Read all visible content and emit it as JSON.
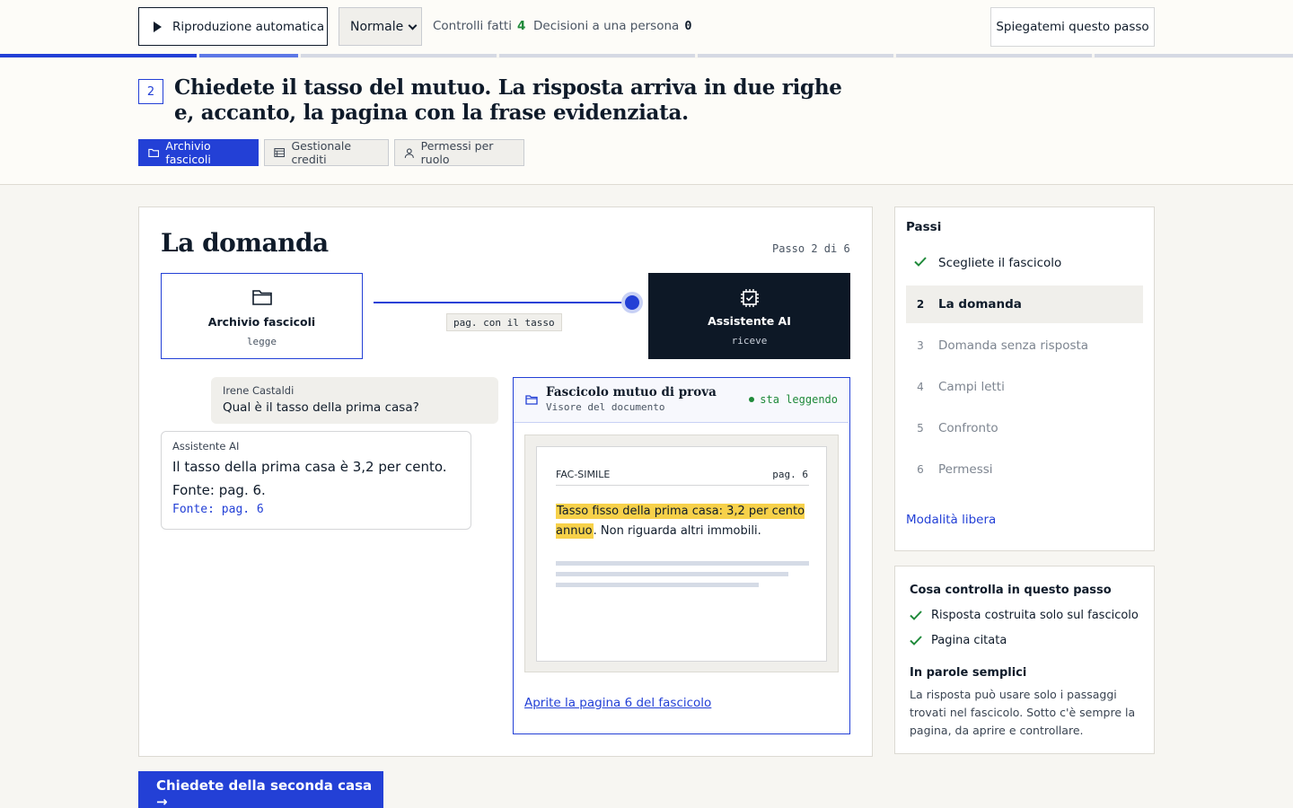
{
  "topbar": {
    "autoplay_label": "Riproduzione automatica",
    "speed_value": "Normale",
    "checks_label": "Controlli fatti",
    "checks_count": "4",
    "decisions_label": "Decisioni a una persona",
    "decisions_count": "0",
    "explain_label": "Spiegatemi questo passo"
  },
  "progress": {
    "segments_total": 6,
    "current_segment": 2,
    "current_segment_fill": 1.0,
    "colors": {
      "done": "#2340d6",
      "current": "#5d78e6",
      "pending": "#d5d9e3"
    }
  },
  "header": {
    "step_number": "2",
    "title": "Chiedete il tasso del mutuo. La risposta arriva in due righe e, accanto, la pagina con la frase evidenziata.",
    "sources": [
      {
        "label": "Archivio fascicoli",
        "icon": "folder-icon",
        "active": true
      },
      {
        "label": "Gestionale crediti",
        "icon": "table-icon",
        "active": false
      },
      {
        "label": "Permessi per ruolo",
        "icon": "person-icon",
        "active": false
      }
    ]
  },
  "card": {
    "title": "La domanda",
    "step_of": "Passo 2 di 6",
    "flow": {
      "source": {
        "name": "Archivio fascicoli",
        "role": "legge",
        "icon": "folder-icon"
      },
      "target": {
        "name": "Assistente AI",
        "role": "riceve",
        "icon": "chip-check-icon"
      },
      "label": "pag. con il tasso"
    },
    "chat": {
      "user_name": "Irene Castaldi",
      "user_msg": "Qual è il tasso della prima casa?",
      "ai_name": "Assistente AI",
      "ai_line1": "Il tasso della prima casa è 3,2 per cento.",
      "ai_line2": "Fonte: pag. 6.",
      "ai_cite": "Fonte: pag. 6"
    },
    "doc": {
      "title": "Fascicolo mutuo di prova",
      "subtitle": "Visore del documento",
      "status": "sta leggendo",
      "page_label": "FAC-SIMILE",
      "page_num": "pag. 6",
      "highlight": "Tasso fisso della prima casa: 3,2 per cento annuo",
      "rest": ". Non riguarda altri immobili.",
      "link": "Aprite la pagina 6 del fascicolo"
    },
    "next_button": "Chiedete della seconda casa →"
  },
  "steps": {
    "head": "Passi",
    "items": [
      {
        "index": "✓",
        "label": "Scegliete il fascicolo",
        "state": "done"
      },
      {
        "index": "2",
        "label": "La domanda",
        "state": "current"
      },
      {
        "index": "3",
        "label": "Domanda senza risposta",
        "state": "future"
      },
      {
        "index": "4",
        "label": "Campi letti",
        "state": "future"
      },
      {
        "index": "5",
        "label": "Confronto",
        "state": "future"
      },
      {
        "index": "6",
        "label": "Permessi",
        "state": "future"
      }
    ],
    "free_mode": "Modalità libera"
  },
  "checks": {
    "head": "Cosa controlla in questo passo",
    "items": [
      "Risposta costruita solo sul fascicolo",
      "Pagina citata"
    ],
    "plain_head": "In parole semplici",
    "plain_text": "La risposta può usare solo i passaggi trovati nel fascicolo. Sotto c'è sempre la pagina, da aprire e controllare."
  },
  "colors": {
    "accent": "#2340d6",
    "ok_green": "#1f8a3a",
    "highlight": "#f7d14a",
    "dark_node": "#0d1826"
  }
}
